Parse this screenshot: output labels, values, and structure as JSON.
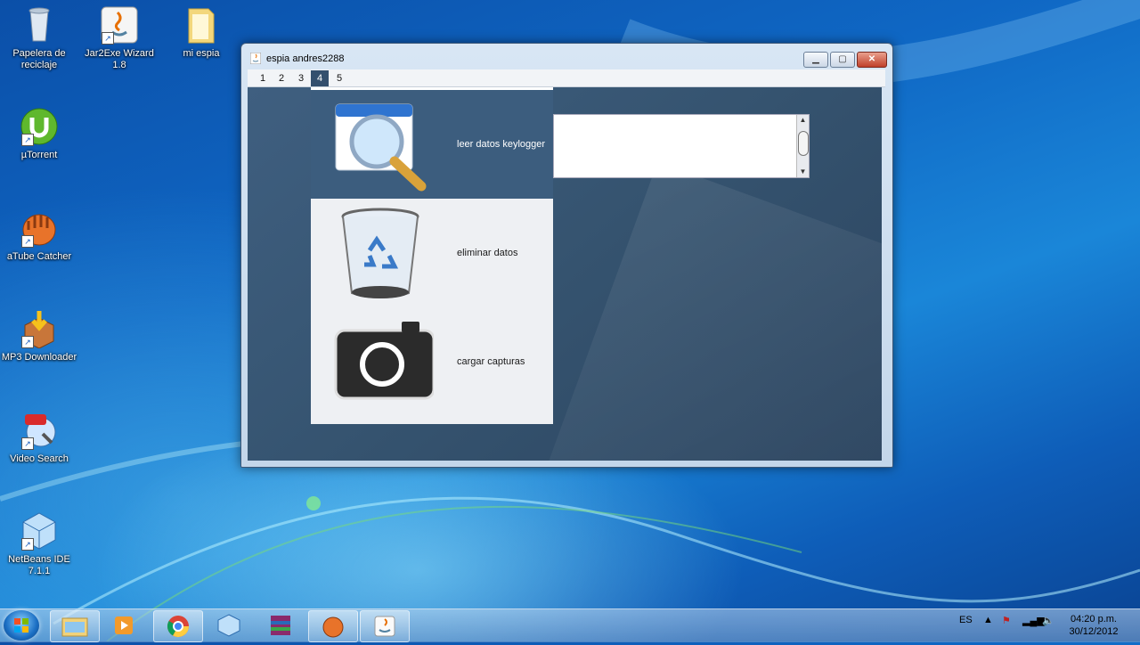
{
  "desktop": {
    "icons": [
      {
        "label": "Papelera de reciclaje",
        "icon": "recycle-bin-icon"
      },
      {
        "label": "Jar2Exe Wizard 1.8",
        "icon": "java-icon"
      },
      {
        "label": "mi espia",
        "icon": "folder-icon"
      },
      {
        "label": "µTorrent",
        "icon": "utorrent-icon"
      },
      {
        "label": "aTube Catcher",
        "icon": "atube-catcher-icon"
      },
      {
        "label": "MP3 Downloader",
        "icon": "mp3-downloader-icon"
      },
      {
        "label": "Video Search",
        "icon": "video-search-icon"
      },
      {
        "label": "NetBeans IDE 7.1.1",
        "icon": "netbeans-icon"
      }
    ]
  },
  "window": {
    "title": "espia andres2288",
    "tabs": [
      "1",
      "2",
      "3",
      "4",
      "5"
    ],
    "active_tab": "4",
    "menu_items": [
      {
        "label": "leer datos keylogger",
        "icon": "magnifier-icon",
        "selected": true
      },
      {
        "label": "eliminar datos",
        "icon": "trash-can-icon",
        "selected": false
      },
      {
        "label": "cargar capturas",
        "icon": "camera-icon",
        "selected": false
      }
    ],
    "text_area_value": ""
  },
  "taskbar": {
    "apps": [
      "windows-explorer-icon",
      "media-player-icon",
      "chrome-icon",
      "netbeans-icon",
      "winrar-icon",
      "atube-catcher-icon",
      "java-icon"
    ],
    "language": "ES",
    "time": "04:20 p.m.",
    "date": "30/12/2012"
  },
  "colors": {
    "selected_item": "#3c5d7e",
    "content_bg": "#35536f",
    "menu_bg": "#eef0f3"
  }
}
